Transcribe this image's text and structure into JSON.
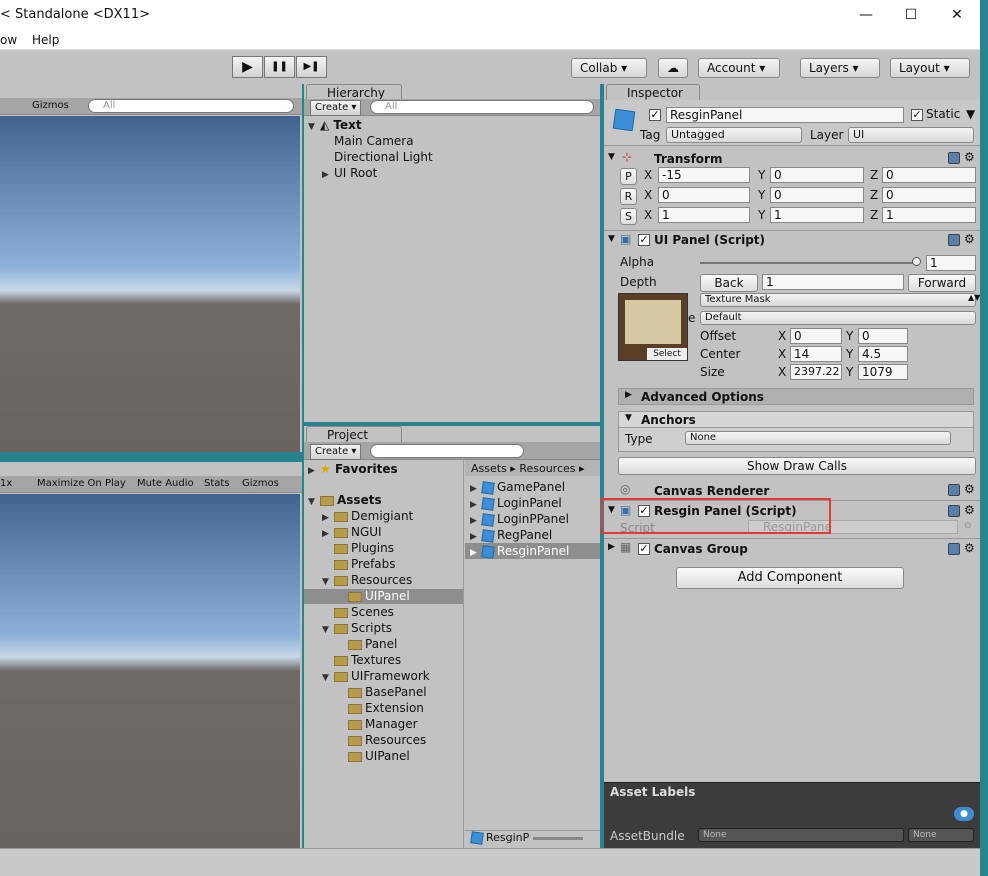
{
  "window": {
    "title": "< Standalone <DX11>",
    "minimize": "—",
    "maximize": "☐",
    "close": "✕"
  },
  "menu": {
    "items": [
      "ow",
      "Help"
    ]
  },
  "toolbar": {
    "play": "▶",
    "pause": "❚❚",
    "step": "▶❚",
    "collab": "Collab",
    "account": "Account",
    "layers": "Layers",
    "layout": "Layout"
  },
  "scene": {
    "gizmos": "Gizmos",
    "search_placeholder": "All"
  },
  "game": {
    "scale": "1x",
    "maximize_on_play": "Maximize On Play",
    "mute_audio": "Mute Audio",
    "stats": "Stats",
    "gizmos": "Gizmos"
  },
  "hierarchy": {
    "tab": "Hierarchy",
    "create": "Create",
    "search_placeholder": "All",
    "scene_name": "Text",
    "items": [
      "Main Camera",
      "Directional Light",
      "UI Root"
    ]
  },
  "project": {
    "tab": "Project",
    "create": "Create",
    "favorites": "Favorites",
    "assets": "Assets",
    "folders": [
      "Demigiant",
      "NGUI",
      "Plugins",
      "Prefabs",
      "Resources",
      "UIPanel",
      "Scenes",
      "Scripts",
      "Panel",
      "Textures",
      "UIFramework",
      "BasePanel",
      "Extension",
      "Manager",
      "Resources",
      "UIPanel"
    ],
    "breadcrumb": [
      "Assets",
      "Resources"
    ],
    "files": [
      "GamePanel",
      "LoginPanel",
      "LoginPPanel",
      "RegPanel",
      "ResginPanel"
    ],
    "bottom_label": "ResginP"
  },
  "inspector": {
    "tab": "Inspector",
    "object_name": "ResginPanel",
    "static_label": "Static",
    "tag_label": "Tag",
    "tag_value": "Untagged",
    "layer_label": "Layer",
    "layer_value": "UI",
    "transform": {
      "title": "Transform",
      "p": {
        "x": "-15",
        "y": "0",
        "z": "0"
      },
      "r": {
        "x": "0",
        "y": "0",
        "z": "0"
      },
      "s": {
        "x": "1",
        "y": "1",
        "z": "1"
      }
    },
    "uipanel": {
      "title": "UI Panel (Script)",
      "alpha_label": "Alpha",
      "alpha_value": "1",
      "depth_label": "Depth",
      "back": "Back",
      "depth_value": "1",
      "forward": "Forward",
      "texture_mask": "Texture Mask",
      "default": "Default",
      "select": "Select",
      "offset_label": "Offset",
      "offset_x": "0",
      "offset_y": "0",
      "center_label": "Center",
      "center_x": "14",
      "center_y": "4.5",
      "size_label": "Size",
      "size_x": "2397.22",
      "size_y": "1079",
      "advanced": "Advanced Options",
      "anchors": "Anchors",
      "type_label": "Type",
      "type_value": "None",
      "show_draw_calls": "Show Draw Calls"
    },
    "canvas_renderer": "Canvas Renderer",
    "resgin": {
      "title": "Resgin Panel (Script)",
      "script_label": "Script",
      "script_value": "ResginPane"
    },
    "canvas_group": "Canvas Group",
    "add_component": "Add Component",
    "asset_labels": "Asset Labels",
    "asset_bundle": "AssetBundle",
    "bundle_value": "None",
    "variant_value": "None",
    "highlight_color": "#e53935"
  }
}
